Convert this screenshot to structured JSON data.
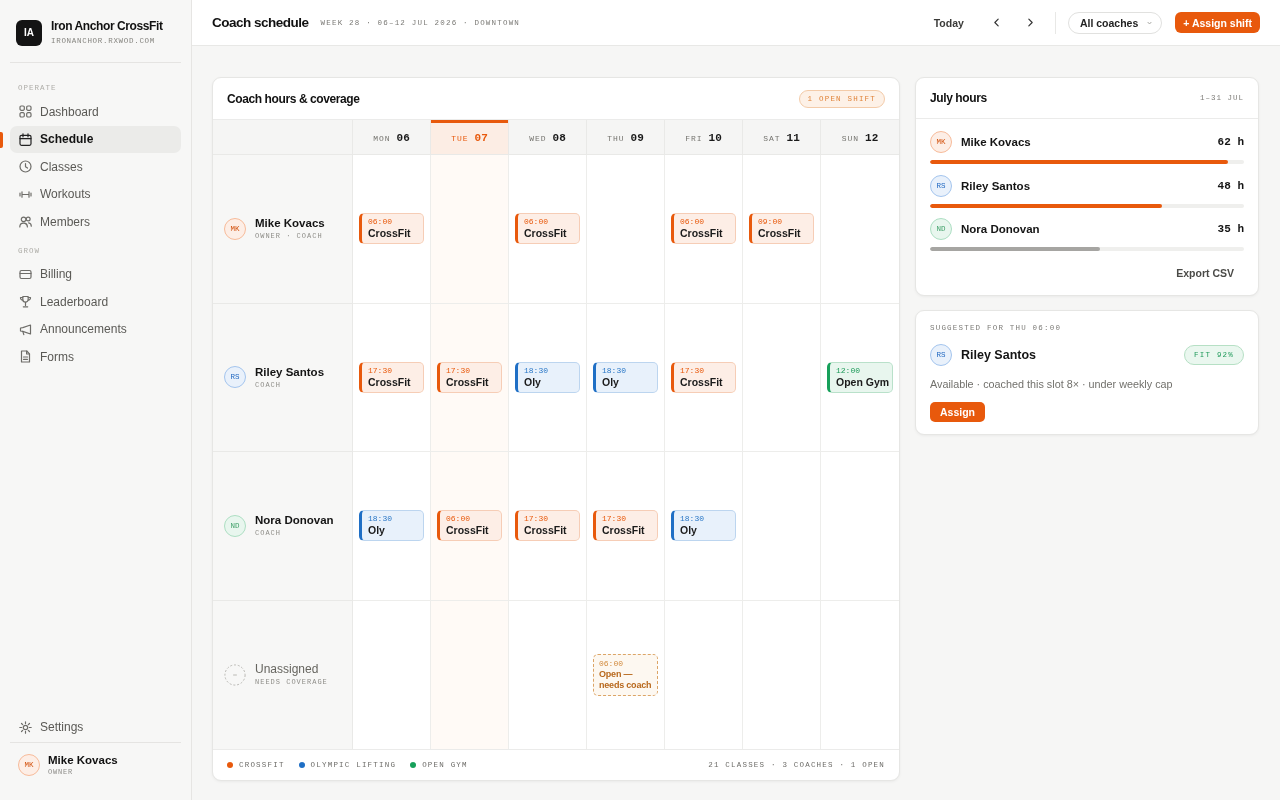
{
  "brand": {
    "logo": "IA",
    "name": "Iron Anchor CrossFit",
    "domain": "IRONANCHOR.RXWOD.COM"
  },
  "sidebar": {
    "sections": [
      {
        "label": "OPERATE",
        "items": [
          {
            "label": "Dashboard",
            "selected": false
          },
          {
            "label": "Schedule",
            "selected": true
          },
          {
            "label": "Classes",
            "selected": false
          },
          {
            "label": "Workouts",
            "selected": false
          },
          {
            "label": "Members",
            "selected": false
          }
        ]
      },
      {
        "label": "GROW",
        "items": [
          {
            "label": "Billing",
            "selected": false
          },
          {
            "label": "Leaderboard",
            "selected": false
          },
          {
            "label": "Announcements",
            "selected": false
          },
          {
            "label": "Forms",
            "selected": false
          }
        ]
      }
    ],
    "bottom_items": [
      {
        "label": "Settings",
        "selected": false
      }
    ],
    "user": {
      "initials": "MK",
      "color": "#fdeee6",
      "name": "Mike Kovacs",
      "role": "OWNER"
    }
  },
  "header": {
    "title": "Coach schedule",
    "subtitle": "WEEK 28 · 06–12 JUL 2026 · DOWNTOWN",
    "today_button": "Today",
    "coach_filter": "All coaches",
    "primary_button": "+ Assign shift"
  },
  "schedule": {
    "title": "Coach hours & coverage",
    "badge": "1 OPEN SHIFT",
    "days": [
      {
        "dow": "MON",
        "date": "06",
        "selected": false
      },
      {
        "dow": "TUE",
        "date": "07",
        "selected": true
      },
      {
        "dow": "WED",
        "date": "08",
        "selected": false
      },
      {
        "dow": "THU",
        "date": "09",
        "selected": false
      },
      {
        "dow": "FRI",
        "date": "10",
        "selected": false
      },
      {
        "dow": "SAT",
        "date": "11",
        "selected": false
      },
      {
        "dow": "SUN",
        "date": "12",
        "selected": false
      }
    ],
    "rows": [
      {
        "kind": "coach",
        "initials": "MK",
        "color": "#fdeee6",
        "name": "Mike Kovacs",
        "role": "OWNER · COACH",
        "cells": [
          {
            "kind": "crossfit",
            "time": "06:00",
            "title": "CrossFit"
          },
          {
            "kind": "empty"
          },
          {
            "kind": "crossfit",
            "time": "06:00",
            "title": "CrossFit"
          },
          {
            "kind": "empty"
          },
          {
            "kind": "crossfit",
            "time": "06:00",
            "title": "CrossFit"
          },
          {
            "kind": "crossfit",
            "time": "09:00",
            "title": "CrossFit"
          },
          {
            "kind": "empty"
          }
        ]
      },
      {
        "kind": "coach",
        "initials": "RS",
        "color": "#e9f1fb",
        "name": "Riley Santos",
        "role": "COACH",
        "cells": [
          {
            "kind": "crossfit",
            "time": "17:30",
            "title": "CrossFit"
          },
          {
            "kind": "crossfit",
            "time": "17:30",
            "title": "CrossFit"
          },
          {
            "kind": "oly",
            "time": "18:30",
            "title": "Oly"
          },
          {
            "kind": "oly",
            "time": "18:30",
            "title": "Oly"
          },
          {
            "kind": "crossfit",
            "time": "17:30",
            "title": "CrossFit"
          },
          {
            "kind": "empty"
          },
          {
            "kind": "open_gym",
            "time": "12:00",
            "title": "Open Gym"
          }
        ]
      },
      {
        "kind": "coach",
        "initials": "ND",
        "color": "#e8f6ee",
        "name": "Nora Donovan",
        "role": "COACH",
        "cells": [
          {
            "kind": "oly",
            "time": "18:30",
            "title": "Oly"
          },
          {
            "kind": "crossfit",
            "time": "06:00",
            "title": "CrossFit"
          },
          {
            "kind": "crossfit",
            "time": "17:30",
            "title": "CrossFit"
          },
          {
            "kind": "crossfit",
            "time": "17:30",
            "title": "CrossFit"
          },
          {
            "kind": "oly",
            "time": "18:30",
            "title": "Oly"
          },
          {
            "kind": "empty"
          },
          {
            "kind": "empty"
          }
        ]
      },
      {
        "kind": "unassigned",
        "name": "Unassigned",
        "role": "NEEDS COVERAGE",
        "cells": [
          {
            "kind": "empty"
          },
          {
            "kind": "empty"
          },
          {
            "kind": "empty"
          },
          {
            "kind": "open",
            "time": "06:00",
            "title": "Open — needs coach"
          },
          {
            "kind": "empty"
          },
          {
            "kind": "empty"
          },
          {
            "kind": "empty"
          }
        ]
      }
    ],
    "legend": [
      {
        "label": "CROSSFIT",
        "color": "#e8590c"
      },
      {
        "label": "OLYMPIC LIFTING",
        "color": "#1f6fc5"
      },
      {
        "label": "OPEN GYM",
        "color": "#17a05a"
      }
    ],
    "summary": "21 CLASSES · 3 COACHES · 1 OPEN"
  },
  "hours": {
    "title": "July hours",
    "range": "1–31 JUL",
    "coaches": [
      {
        "initials": "MK",
        "color": "#fdeee6",
        "name": "Mike Kovacs",
        "hours": "62 h",
        "level": 0.95,
        "highlighted": true
      },
      {
        "initials": "RS",
        "color": "#e9f1fb",
        "name": "Riley Santos",
        "hours": "48 h",
        "level": 0.74,
        "highlighted": true
      },
      {
        "initials": "ND",
        "color": "#e8f6ee",
        "name": "Nora Donovan",
        "hours": "35 h",
        "level": 0.54,
        "highlighted": false
      }
    ],
    "export_button": "Export CSV"
  },
  "suggestion": {
    "label": "SUGGESTED FOR THU 06:00",
    "initials": "RS",
    "color": "#e9f1fb",
    "name": "Riley Santos",
    "fit": "FIT 92%",
    "note": "Available · coached this slot 8× · under weekly cap",
    "button": "Assign"
  }
}
